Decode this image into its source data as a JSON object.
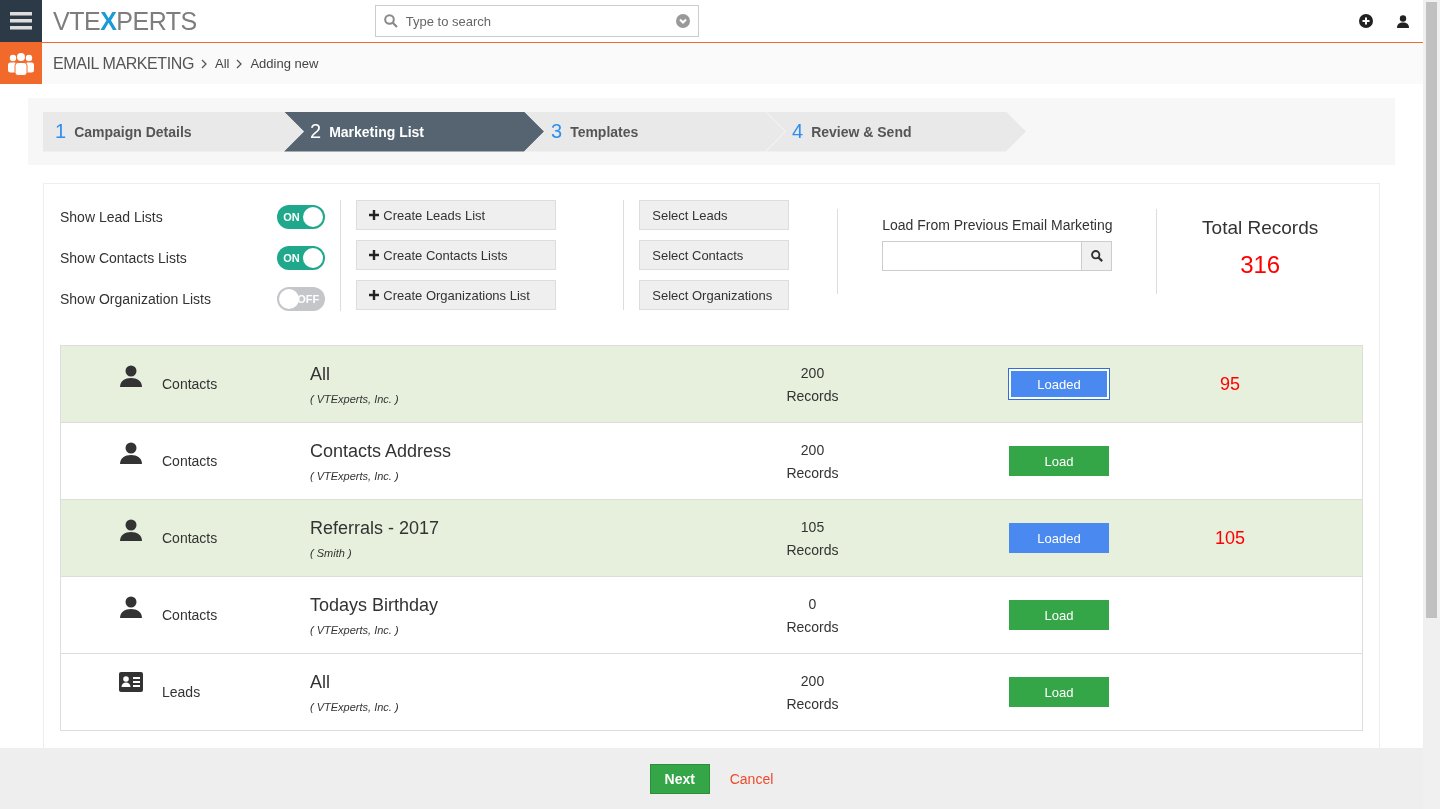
{
  "header": {
    "logo": "VTEXPERTS",
    "search": {
      "placeholder": "Type to search"
    }
  },
  "breadcrumb": {
    "module": "EMAIL MARKETING",
    "items": [
      "All",
      "Adding new"
    ]
  },
  "steps": [
    {
      "number": "1",
      "label": "Campaign Details",
      "selected": false
    },
    {
      "number": "2",
      "label": "Marketing List",
      "selected": true
    },
    {
      "number": "3",
      "label": "Templates",
      "selected": false
    },
    {
      "number": "4",
      "label": "Review & Send",
      "selected": false
    }
  ],
  "toggles": [
    {
      "label": "Show Lead Lists",
      "on": true,
      "text": "ON"
    },
    {
      "label": "Show Contacts Lists",
      "on": true,
      "text": "ON"
    },
    {
      "label": "Show Organization Lists",
      "on": false,
      "text": "OFF"
    }
  ],
  "create_buttons": [
    "Create Leads List",
    "Create Contacts Lists",
    "Create Organizations List"
  ],
  "select_buttons": [
    "Select Leads",
    "Select Contacts",
    "Select Organizations"
  ],
  "previous": {
    "label": "Load From Previous Email Marketing"
  },
  "total": {
    "label": "Total Records",
    "value": "316"
  },
  "lists": [
    {
      "kind": "contact",
      "module": "Contacts",
      "name": "All",
      "owner": "( VTExperts, Inc. )",
      "count": "200",
      "unit": "Records",
      "loaded": true,
      "focused": true,
      "button": "Loaded",
      "loaded_count": "95"
    },
    {
      "kind": "contact",
      "module": "Contacts",
      "name": "Contacts Address",
      "owner": "( VTExperts, Inc. )",
      "count": "200",
      "unit": "Records",
      "loaded": false,
      "focused": false,
      "button": "Load"
    },
    {
      "kind": "contact",
      "module": "Contacts",
      "name": "Referrals - 2017",
      "owner": "( Smith )",
      "count": "105",
      "unit": "Records",
      "loaded": true,
      "focused": false,
      "button": "Loaded",
      "loaded_count": "105"
    },
    {
      "kind": "contact",
      "module": "Contacts",
      "name": "Todays Birthday",
      "owner": "( VTExperts, Inc. )",
      "count": "0",
      "unit": "Records",
      "loaded": false,
      "focused": false,
      "button": "Load"
    },
    {
      "kind": "lead",
      "module": "Leads",
      "name": "All",
      "owner": "( VTExperts, Inc. )",
      "count": "200",
      "unit": "Records",
      "loaded": false,
      "focused": false,
      "button": "Load"
    }
  ],
  "footer": {
    "next": "Next",
    "cancel": "Cancel"
  }
}
